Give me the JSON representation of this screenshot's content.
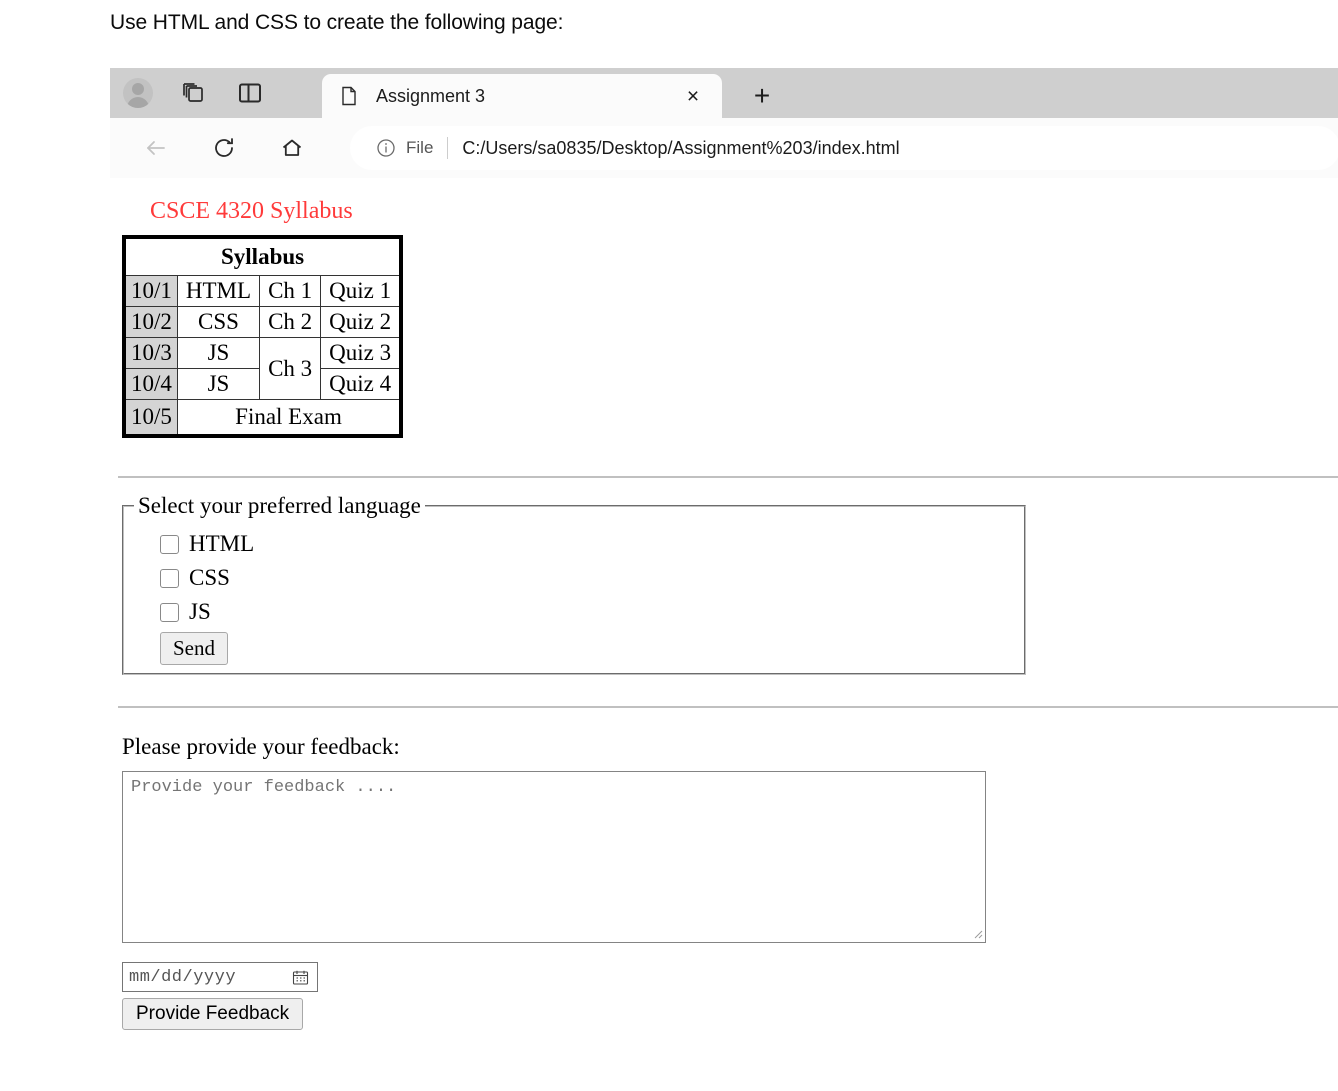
{
  "instruction": "Use HTML and CSS to create the following page:",
  "browser": {
    "chrome_icons": [
      "profile-avatar-icon",
      "tab-collections-icon",
      "split-screen-icon"
    ],
    "tab": {
      "title": "Assignment 3",
      "favicon": "page-file-icon",
      "close_label": "×"
    },
    "new_tab_label": "+",
    "nav": {
      "back": "back-arrow-icon",
      "reload": "reload-icon",
      "home": "home-icon"
    },
    "omnibox": {
      "info_icon": "info-circle-icon",
      "scheme_label": "File",
      "url": "C:/Users/sa0835/Desktop/Assignment%203/index.html"
    }
  },
  "page": {
    "heading": "CSCE 4320 Syllabus",
    "heading_color": "#ff3a3a",
    "table": {
      "caption": "Syllabus",
      "rows": [
        {
          "date": "10/1",
          "topic": "HTML",
          "chapter": "Ch 1",
          "quiz": "Quiz 1"
        },
        {
          "date": "10/2",
          "topic": "CSS",
          "chapter": "Ch 2",
          "quiz": "Quiz 2"
        },
        {
          "date": "10/3",
          "topic": "JS",
          "chapter": "Ch 3",
          "quiz": "Quiz 3"
        },
        {
          "date": "10/4",
          "topic": "JS",
          "chapter": "",
          "quiz": "Quiz 4"
        },
        {
          "date": "10/5",
          "topic": "Final Exam",
          "chapter": "",
          "quiz": ""
        }
      ],
      "date_cell_bg": "#d4d4d4"
    },
    "language_fieldset": {
      "legend": "Select your preferred language",
      "options": [
        {
          "label": "HTML",
          "checked": false
        },
        {
          "label": "CSS",
          "checked": false
        },
        {
          "label": "JS",
          "checked": false
        }
      ],
      "submit_label": "Send"
    },
    "feedback": {
      "label": "Please provide your feedback:",
      "textarea_placeholder": "Provide your feedback ....",
      "date_placeholder": "mm/dd/yyyy",
      "date_icon": "calendar-icon",
      "submit_label": "Provide Feedback"
    }
  }
}
